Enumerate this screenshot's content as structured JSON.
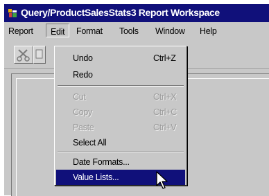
{
  "window": {
    "title": "Query/ProductSalesStats3 Report Workspace",
    "icon": "app-icon"
  },
  "menubar": {
    "items": [
      "Report",
      "Edit",
      "Format",
      "Tools",
      "Window",
      "Help"
    ]
  },
  "toolbar": {
    "buttons": [
      "cut-icon",
      "copy-icon"
    ]
  },
  "edit_menu": {
    "items": [
      {
        "label": "Undo",
        "shortcut": "Ctrl+Z",
        "enabled": true
      },
      {
        "label": "Redo",
        "shortcut": "",
        "enabled": true
      },
      {
        "label": "Cut",
        "shortcut": "Ctrl+X",
        "enabled": false
      },
      {
        "label": "Copy",
        "shortcut": "Ctrl+C",
        "enabled": false
      },
      {
        "label": "Paste",
        "shortcut": "Ctrl+V",
        "enabled": false
      },
      {
        "label": "Select All",
        "shortcut": "",
        "enabled": true
      },
      {
        "label": "Date Formats...",
        "shortcut": "",
        "enabled": true
      },
      {
        "label": "Value Lists...",
        "shortcut": "",
        "enabled": true,
        "highlighted": true
      }
    ]
  },
  "colors": {
    "titlebar": "#10107a",
    "highlight": "#10107a",
    "face": "#c8c8c8"
  }
}
